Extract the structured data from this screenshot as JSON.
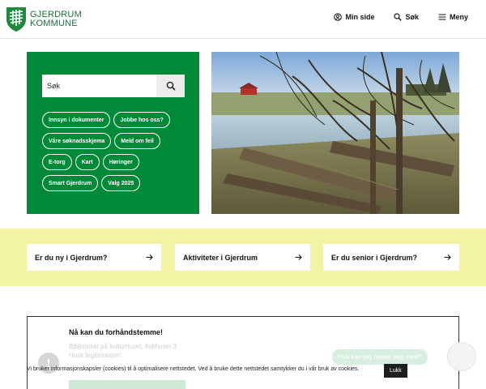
{
  "header": {
    "logo_line1": "GJERDRUM",
    "logo_line2": "KOMMUNE",
    "nav": [
      {
        "label": "Min side",
        "icon": "user-circle-icon"
      },
      {
        "label": "Søk",
        "icon": "search-icon"
      },
      {
        "label": "Meny",
        "icon": "menu-icon"
      }
    ]
  },
  "hero": {
    "search_placeholder": "Søk",
    "chips": [
      "Innsyn i dokumenter",
      "Jobbe hos oss?",
      "Våre søknadsskjema",
      "Meld om feil",
      "E-torg",
      "Kart",
      "Høringer",
      "Smart Gjerdrum",
      "Valg 2025"
    ]
  },
  "cards": [
    {
      "label": "Er du ny i Gjerdrum?"
    },
    {
      "label": "Aktiviteter i Gjerdrum"
    },
    {
      "label": "Er du senior i Gjerdrum?"
    }
  ],
  "info": {
    "title": "Nå kan du forhåndstemme!",
    "line1": "Biblioteket på kulturhuset, Askhuset 3",
    "line2": "Husk legitimasjon!",
    "icon": "!"
  },
  "chat": {
    "label": "Hva kan jeg hjelpe deg med?"
  },
  "cookie": {
    "text": "Vi bruker informasjonskapsler (cookies) til å optimalisere nettstedet. Ved å bruke dette nettstedet samtykker du i vår bruk av cookies.",
    "button": "Lukk"
  },
  "colors": {
    "brand_green": "#008a37",
    "band_yellow": "#f3f3a4"
  }
}
